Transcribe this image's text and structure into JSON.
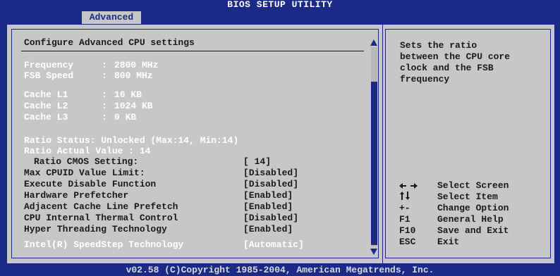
{
  "window": {
    "title": "BIOS SETUP UTILITY"
  },
  "tabs": [
    {
      "label": "Advanced"
    }
  ],
  "section": {
    "heading": "Configure Advanced CPU settings"
  },
  "info": [
    {
      "label": "Frequency",
      "value": "2800 MHz"
    },
    {
      "label": "FSB Speed",
      "value": "800 MHz"
    },
    {
      "label": "Cache L1",
      "value": "16 KB"
    },
    {
      "label": "Cache L2",
      "value": "1024 KB"
    },
    {
      "label": "Cache L3",
      "value": "0 KB"
    }
  ],
  "ratio": {
    "status": "Ratio Status: Unlocked (Max:14, Min:14)",
    "actual": "Ratio Actual Value : 14"
  },
  "settings": [
    {
      "label": "Ratio CMOS Setting:",
      "value": "[ 14]"
    },
    {
      "label": "Max CPUID Value Limit:",
      "value": "[Disabled]"
    },
    {
      "label": "Execute Disable Function",
      "value": "[Disabled]"
    },
    {
      "label": "Hardware Prefetcher",
      "value": "[Enabled]"
    },
    {
      "label": "Adjacent Cache Line Prefetch",
      "value": "[Enabled]"
    },
    {
      "label": "CPU Internal Thermal Control",
      "value": "[Disabled]"
    },
    {
      "label": "Hyper Threading Technology",
      "value": "[Enabled]"
    },
    {
      "label": "Intel(R) SpeedStep Technology",
      "value": "[Automatic]"
    }
  ],
  "help": {
    "lines": [
      "Sets the ratio",
      "between the CPU core",
      "clock and the FSB",
      "frequency"
    ]
  },
  "keys": [
    {
      "key": "",
      "desc": "Select Screen"
    },
    {
      "key": "",
      "desc": "Select Item"
    },
    {
      "key": "+-",
      "desc": "Change Option"
    },
    {
      "key": "F1",
      "desc": "General Help"
    },
    {
      "key": "F10",
      "desc": "Save and Exit"
    },
    {
      "key": "ESC",
      "desc": "Exit"
    }
  ],
  "footer": {
    "text": "v02.58 (C)Copyright 1985-2004, American Megatrends, Inc."
  }
}
